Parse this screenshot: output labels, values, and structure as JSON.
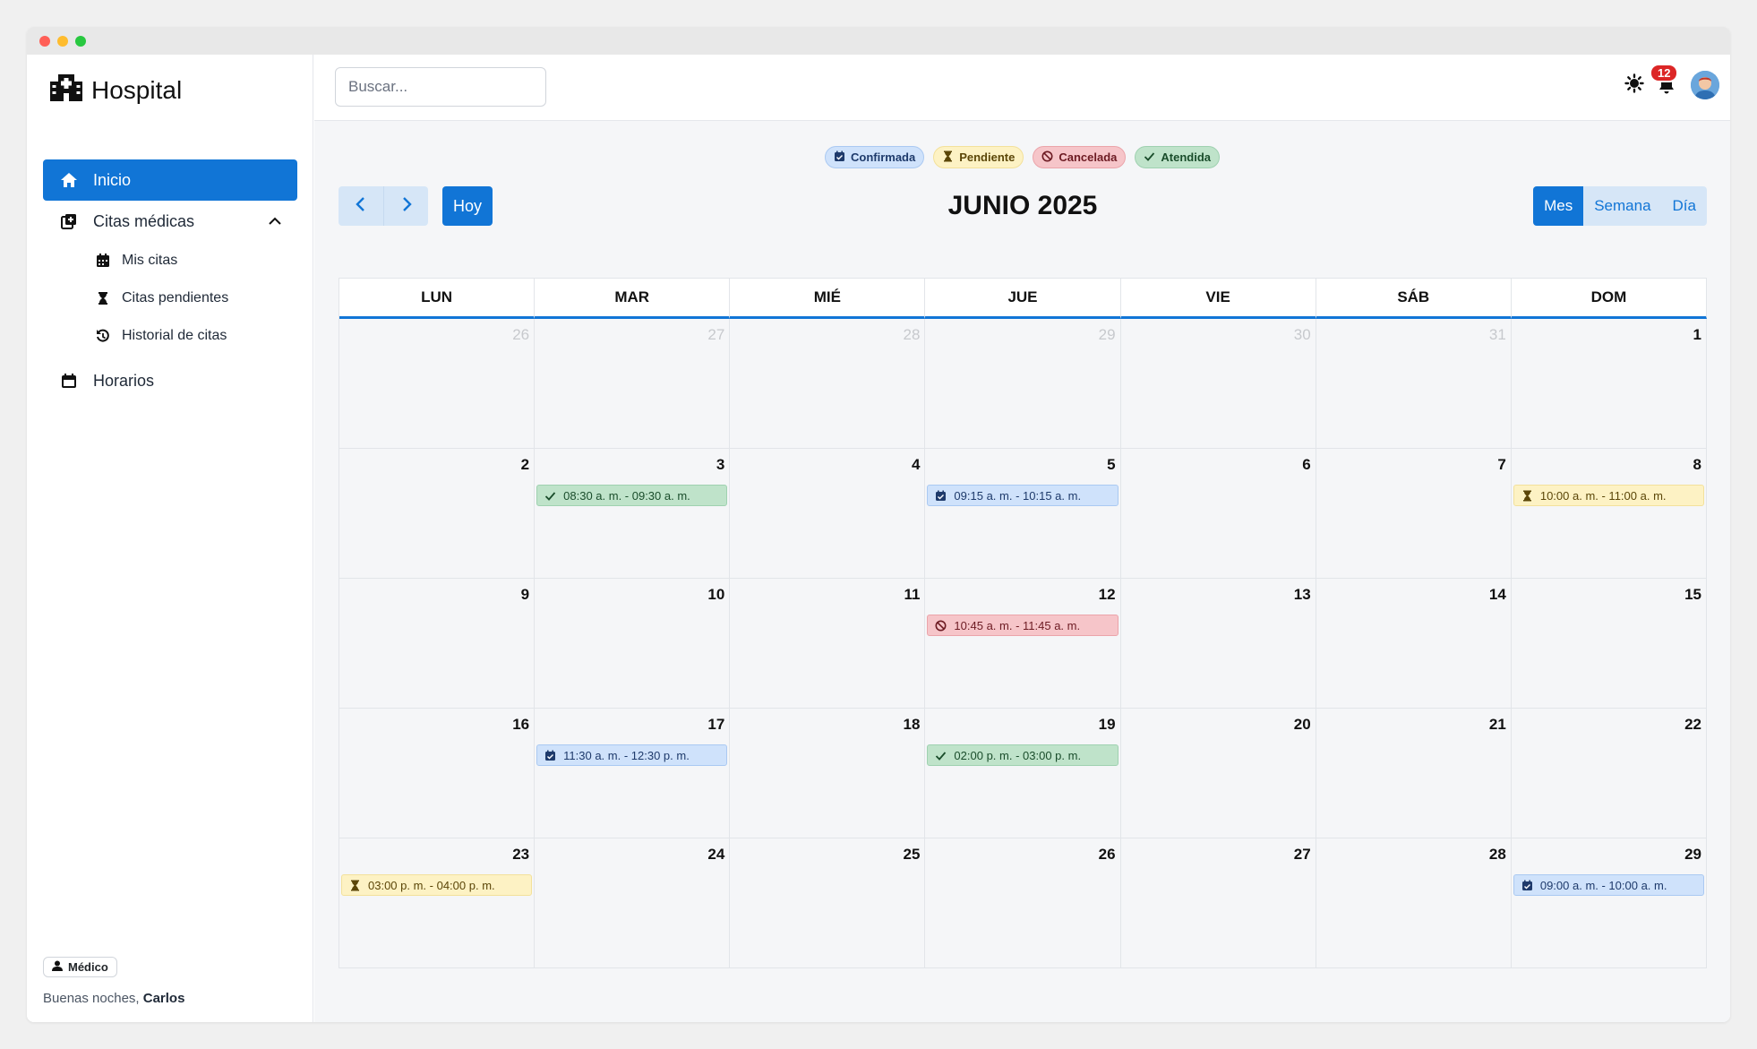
{
  "window": {
    "dots": [
      "#ff5f57",
      "#febc2e",
      "#28c840"
    ]
  },
  "brand": {
    "name": "Hospital",
    "icon": "hospital-icon"
  },
  "sidebar": {
    "items": [
      {
        "label": "Inicio",
        "icon": "home-icon",
        "active": true
      },
      {
        "label": "Citas médicas",
        "icon": "calendar-plus-icon",
        "expanded": true,
        "children": [
          {
            "label": "Mis citas",
            "icon": "calendar-icon"
          },
          {
            "label": "Citas pendientes",
            "icon": "hourglass-icon"
          },
          {
            "label": "Historial de citas",
            "icon": "history-icon"
          }
        ]
      },
      {
        "label": "Horarios",
        "icon": "calendar-icon"
      }
    ],
    "role": "Médico",
    "greeting": "Buenas noches,",
    "user": "Carlos"
  },
  "topbar": {
    "search_placeholder": "Buscar...",
    "notifications": "12"
  },
  "legend": [
    {
      "label": "Confirmada",
      "status": "confirmada"
    },
    {
      "label": "Pendiente",
      "status": "pendiente"
    },
    {
      "label": "Cancelada",
      "status": "cancelada"
    },
    {
      "label": "Atendida",
      "status": "atendida"
    }
  ],
  "toolbar": {
    "today": "Hoy",
    "title": "JUNIO 2025",
    "views": [
      "Mes",
      "Semana",
      "Día"
    ],
    "active_view": "Mes"
  },
  "calendar": {
    "weekdays": [
      "LUN",
      "MAR",
      "MIÉ",
      "JUE",
      "VIE",
      "SÁB",
      "DOM"
    ],
    "weeks": [
      [
        {
          "d": "26",
          "other": true
        },
        {
          "d": "27",
          "other": true
        },
        {
          "d": "28",
          "other": true
        },
        {
          "d": "29",
          "other": true
        },
        {
          "d": "30",
          "other": true
        },
        {
          "d": "31",
          "other": true
        },
        {
          "d": "1"
        }
      ],
      [
        {
          "d": "2"
        },
        {
          "d": "3",
          "event": {
            "time": "08:30 a. m. - 09:30 a. m.",
            "status": "atendida"
          }
        },
        {
          "d": "4"
        },
        {
          "d": "5",
          "event": {
            "time": "09:15 a. m. - 10:15 a. m.",
            "status": "confirmada"
          }
        },
        {
          "d": "6"
        },
        {
          "d": "7"
        },
        {
          "d": "8",
          "event": {
            "time": "10:00 a. m. - 11:00 a. m.",
            "status": "pendiente"
          }
        }
      ],
      [
        {
          "d": "9"
        },
        {
          "d": "10"
        },
        {
          "d": "11"
        },
        {
          "d": "12",
          "event": {
            "time": "10:45 a. m. - 11:45 a. m.",
            "status": "cancelada"
          }
        },
        {
          "d": "13"
        },
        {
          "d": "14"
        },
        {
          "d": "15"
        }
      ],
      [
        {
          "d": "16"
        },
        {
          "d": "17",
          "event": {
            "time": "11:30 a. m. - 12:30 p. m.",
            "status": "confirmada"
          }
        },
        {
          "d": "18"
        },
        {
          "d": "19",
          "event": {
            "time": "02:00 p. m. - 03:00 p. m.",
            "status": "atendida"
          }
        },
        {
          "d": "20"
        },
        {
          "d": "21"
        },
        {
          "d": "22"
        }
      ],
      [
        {
          "d": "23",
          "event": {
            "time": "03:00 p. m. - 04:00 p. m.",
            "status": "pendiente"
          }
        },
        {
          "d": "24"
        },
        {
          "d": "25"
        },
        {
          "d": "26"
        },
        {
          "d": "27"
        },
        {
          "d": "28"
        },
        {
          "d": "29",
          "event": {
            "time": "09:00 a. m. - 10:00 a. m.",
            "status": "confirmada"
          }
        }
      ]
    ]
  },
  "colors": {
    "accent": "#1175d6",
    "confirmada": "#cfe2fb",
    "pendiente": "#fdf2c4",
    "cancelada": "#f6c5c9",
    "atendida": "#bfe3ca",
    "notification_badge": "#dc2626"
  }
}
